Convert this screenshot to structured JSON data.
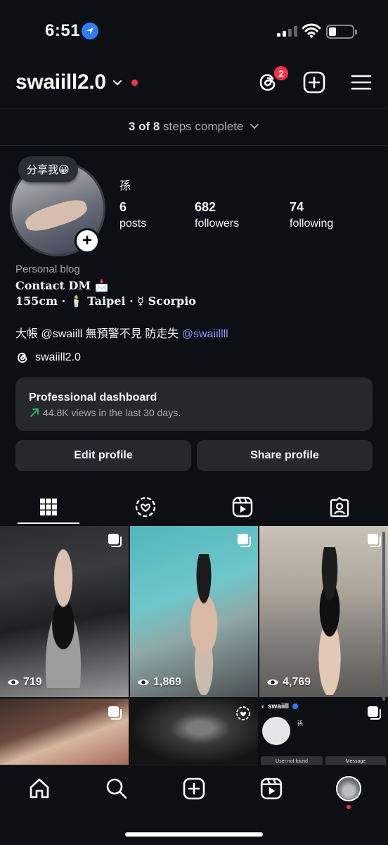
{
  "status_bar": {
    "time": "6:51"
  },
  "header": {
    "username": "swaiill2.0",
    "threads_badge": "2"
  },
  "steps": {
    "count": "3 of 8",
    "text": "steps complete"
  },
  "profile": {
    "share_bubble": "分享我😀",
    "display_name": "孫",
    "stats": [
      {
        "num": "6",
        "label": "posts"
      },
      {
        "num": "682",
        "label": "followers"
      },
      {
        "num": "74",
        "label": "following"
      }
    ],
    "category": "Personal blog",
    "bio_line1": "Contact DM 📩",
    "bio_line2": "155cm · 🕯️ Taipei · ☿ Scorpio",
    "bio_text": "大帳 @swaiill 無預警不見 防走失 ",
    "bio_link": "@swaiillll",
    "threads_handle": "swaiill2.0"
  },
  "dashboard": {
    "title": "Professional dashboard",
    "subtitle": "44.8K views in the last 30 days."
  },
  "buttons": {
    "edit": "Edit profile",
    "share": "Share profile"
  },
  "tabs": [
    "grid-icon",
    "reels-activity-icon",
    "reels-icon",
    "tagged-icon"
  ],
  "grid": [
    {
      "views": "719",
      "multi": true
    },
    {
      "views": "1,869",
      "multi": true
    },
    {
      "views": "4,769",
      "multi": true
    },
    {
      "views": "",
      "multi": true
    },
    {
      "views": "",
      "multi": false
    },
    {
      "views": "",
      "multi": true
    }
  ],
  "mini_profile": {
    "username": "swaiill",
    "name": "孫",
    "btn1": "User not found",
    "btn2": "Message"
  },
  "colors": {
    "accent_red": "#ff3040",
    "link": "#8c95ff",
    "background": "#0c1014",
    "card": "#25292e"
  }
}
